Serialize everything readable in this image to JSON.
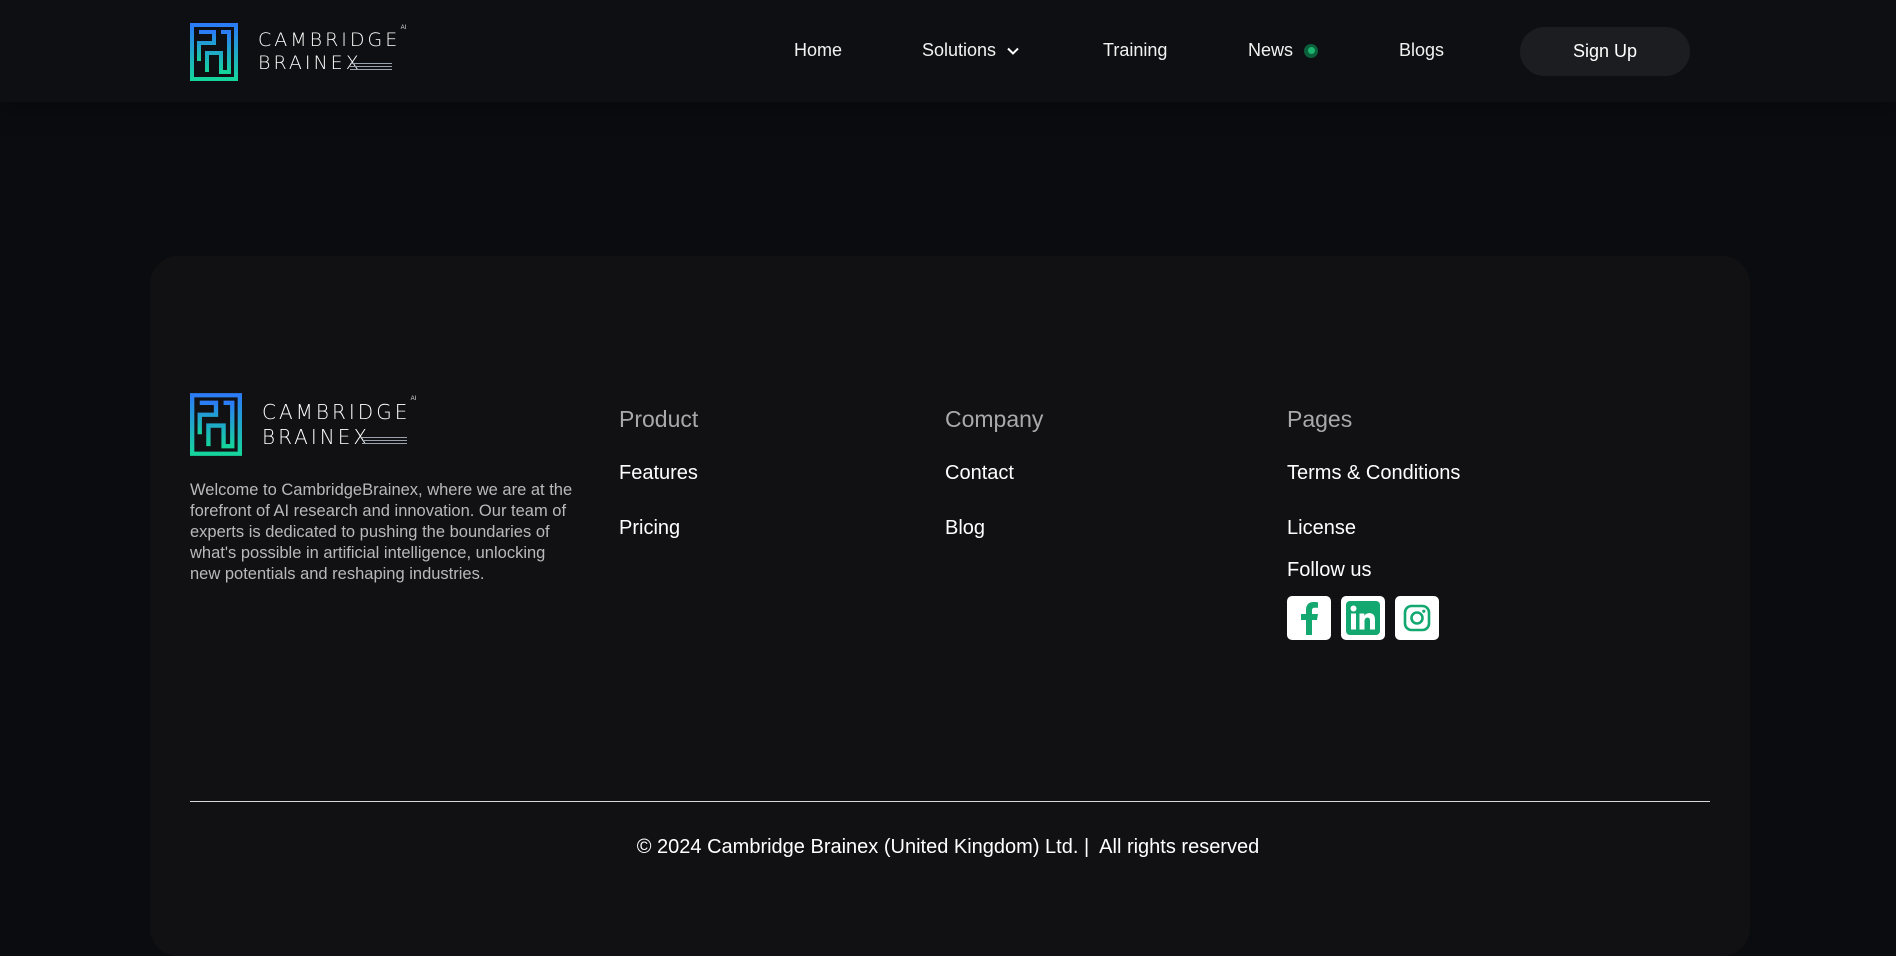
{
  "brand": {
    "line1": "CAMBRIDGE",
    "line2": "BRAINEX",
    "superscript": "AI",
    "logo_icon": "maze-logo-icon",
    "gradient_colors": [
      "#2b7cf6",
      "#15d49c"
    ]
  },
  "header": {
    "nav": {
      "home": "Home",
      "solutions": "Solutions",
      "training": "Training",
      "news": "News",
      "blogs": "Blogs"
    },
    "signup_label": "Sign Up",
    "news_indicator_color": "#1cb36e"
  },
  "footer": {
    "about": "Welcome to CambridgeBrainex, where we are at the forefront of AI research and innovation. Our team of experts is dedicated to pushing the boundaries of what's possible in artificial intelligence, unlocking new potentials and reshaping industries.",
    "columns": [
      {
        "title": "Product",
        "links": [
          "Features",
          "Pricing"
        ]
      },
      {
        "title": "Company",
        "links": [
          "Contact",
          "Blog"
        ]
      },
      {
        "title": "Pages",
        "links": [
          "Terms & Conditions",
          "License"
        ]
      }
    ],
    "follow_label": "Follow us",
    "socials": [
      {
        "icon": "facebook-icon"
      },
      {
        "icon": "linkedin-icon"
      },
      {
        "icon": "instagram-icon"
      }
    ],
    "social_color": "#12a870",
    "copyright": "© 2024 Cambridge Brainex (United Kingdom) Ltd. |  All rights reserved"
  }
}
